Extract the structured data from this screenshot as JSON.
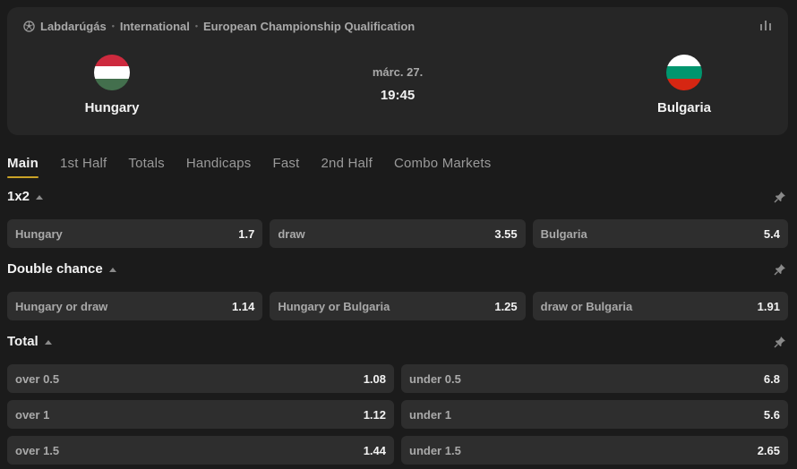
{
  "breadcrumb": {
    "sport": "Labdarúgás",
    "country": "International",
    "league": "European Championship Qualification"
  },
  "match": {
    "home": "Hungary",
    "away": "Bulgaria",
    "date": "márc. 27.",
    "time": "19:45"
  },
  "flags": {
    "hungary": [
      "#cd2a3e",
      "#ffffff",
      "#436f4d"
    ],
    "bulgaria": [
      "#ffffff",
      "#00966e",
      "#d62612"
    ]
  },
  "tabs": [
    "Main",
    "1st Half",
    "Totals",
    "Handicaps",
    "Fast",
    "2nd Half",
    "Combo Markets"
  ],
  "markets": {
    "x12": {
      "title": "1x2",
      "odds": [
        {
          "label": "Hungary",
          "value": "1.7"
        },
        {
          "label": "draw",
          "value": "3.55"
        },
        {
          "label": "Bulgaria",
          "value": "5.4"
        }
      ]
    },
    "double_chance": {
      "title": "Double chance",
      "odds": [
        {
          "label": "Hungary or draw",
          "value": "1.14"
        },
        {
          "label": "Hungary or Bulgaria",
          "value": "1.25"
        },
        {
          "label": "draw or Bulgaria",
          "value": "1.91"
        }
      ]
    },
    "total": {
      "title": "Total",
      "rows": [
        [
          {
            "label": "over 0.5",
            "value": "1.08"
          },
          {
            "label": "under 0.5",
            "value": "6.8"
          }
        ],
        [
          {
            "label": "over 1",
            "value": "1.12"
          },
          {
            "label": "under 1",
            "value": "5.6"
          }
        ],
        [
          {
            "label": "over 1.5",
            "value": "1.44"
          },
          {
            "label": "under 1.5",
            "value": "2.65"
          }
        ]
      ]
    }
  },
  "colors": {
    "accent": "#c9a227",
    "background": "#1b1b1b",
    "card": "#262626",
    "odd_button": "#2e2e2e"
  }
}
